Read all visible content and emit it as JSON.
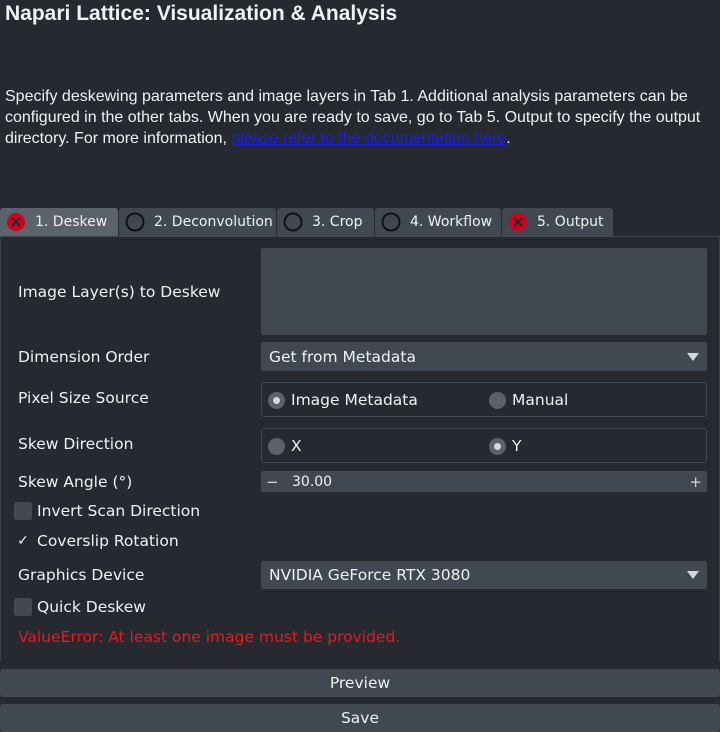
{
  "window": {
    "title": "Napari Lattice: Visualization & Analysis"
  },
  "intro": {
    "text": "Specify deskewing parameters and image layers in Tab 1.  Additional analysis parameters can be configured in the other tabs.  When you are ready to save, go to Tab 5.  Output to specify the output directory.  For more information, ",
    "link_text": "please refer to the documentation here",
    "end": "."
  },
  "tabs": [
    {
      "label": "1. Deskew",
      "status": "error",
      "active": true
    },
    {
      "label": "2. Deconvolution",
      "status": "unset"
    },
    {
      "label": "3. Crop",
      "status": "unset"
    },
    {
      "label": "4. Workflow",
      "status": "unset"
    },
    {
      "label": "5. Output",
      "status": "error"
    }
  ],
  "form": {
    "image_layers": {
      "label": "Image Layer(s) to Deskew",
      "value": ""
    },
    "dimension_order": {
      "label": "Dimension Order",
      "value": "Get from Metadata"
    },
    "pixel_size_source": {
      "label": "Pixel Size Source",
      "options": [
        "Image Metadata",
        "Manual"
      ],
      "selected": "Image Metadata"
    },
    "skew_direction": {
      "label": "Skew Direction",
      "options": [
        "X",
        "Y"
      ],
      "selected": "Y"
    },
    "skew_angle": {
      "label": "Skew Angle (°)",
      "value": "30.00",
      "minus": "−",
      "plus": "+"
    },
    "invert_scan": {
      "label": "Invert Scan Direction",
      "checked": false
    },
    "coverslip_rotation": {
      "label": "Coverslip Rotation",
      "checked": true
    },
    "graphics_device": {
      "label": "Graphics Device",
      "value": "NVIDIA GeForce RTX 3080"
    },
    "quick_deskew": {
      "label": "Quick Deskew",
      "checked": false
    },
    "error": "ValueError: At least one image must be provided."
  },
  "buttons": {
    "preview": "Preview",
    "save": "Save"
  },
  "colors": {
    "background": "#262930",
    "widget": "#414851",
    "error_text": "#e31c1c",
    "error_icon": "#d0021b",
    "link": "#1d1de0"
  }
}
